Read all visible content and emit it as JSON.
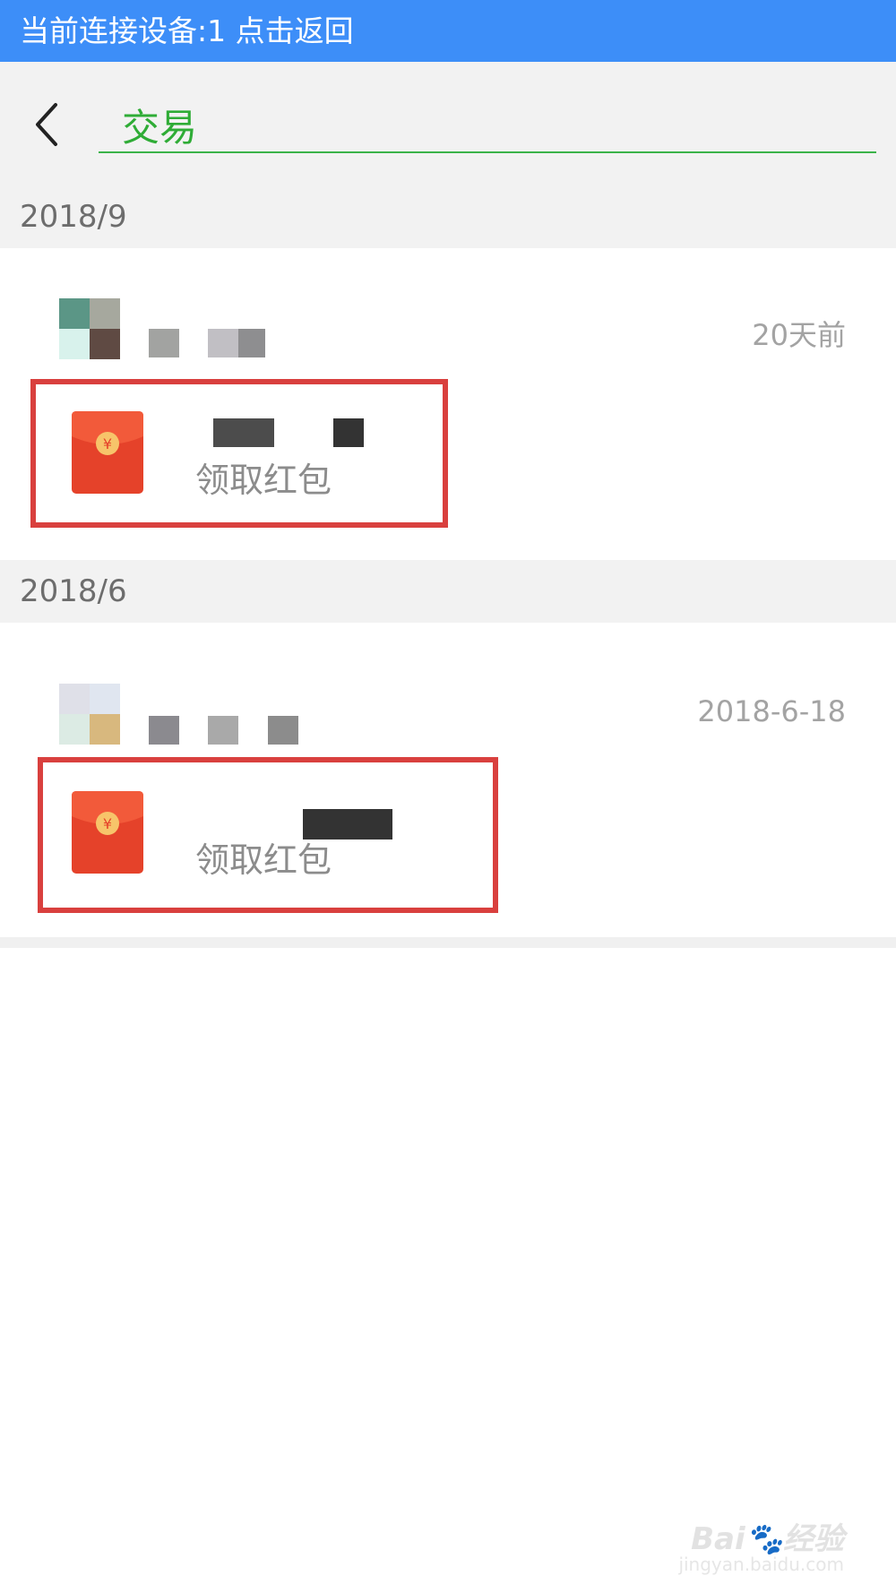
{
  "status_bar": {
    "text": "当前连接设备:1 点击返回"
  },
  "search": {
    "query": "交易"
  },
  "sections": [
    {
      "date": "2018/9",
      "item": {
        "time": "20天前",
        "message": "领取红包"
      }
    },
    {
      "date": "2018/6",
      "item": {
        "time": "2018-6-18",
        "message": "领取红包"
      }
    }
  ],
  "colors": {
    "status_bar": "#3d8ef8",
    "search_accent": "#2fac36",
    "highlight": "#d9403e",
    "envelope": "#e5422a"
  },
  "icons": {
    "back": "chevron-left-icon",
    "envelope": "red-envelope-icon"
  }
}
